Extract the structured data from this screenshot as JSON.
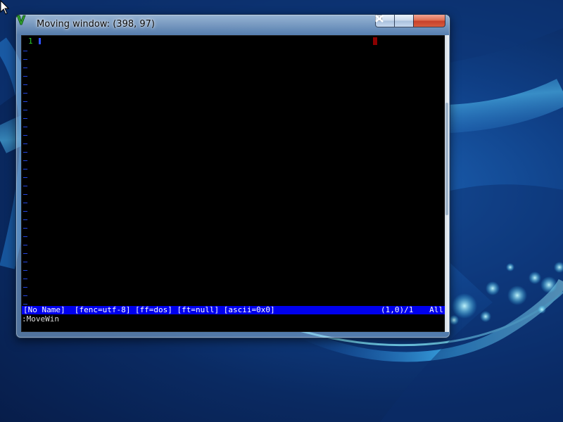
{
  "window": {
    "title": "Moving window: (398, 97)",
    "app_icon": "vim-icon",
    "controls": {
      "minimize_icon": "minimize-icon",
      "maximize_icon": "maximize-icon",
      "close_icon": "close-icon"
    }
  },
  "editor": {
    "line_number": "1",
    "line_number_color": "#2ecc2e",
    "cursor_color": "#3050ff",
    "marker_color": "#8b0000",
    "status_line": {
      "left": "[No Name]  [fenc=utf-8] [ff=dos] [ft=null] [ascii=0x0]",
      "position": "(1,0)/1",
      "scroll": "All",
      "background": "#0000ee"
    },
    "command_line": ":MoveWin"
  },
  "desktop": {
    "wallpaper": "blue-swirl-wallpaper",
    "pointer_icon": "mouse-pointer-icon"
  }
}
